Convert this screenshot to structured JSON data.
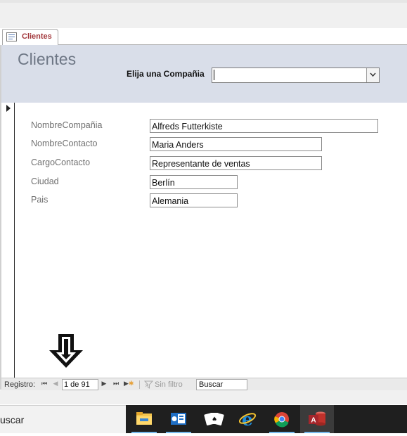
{
  "tab": {
    "label": "Clientes",
    "icon": "form-icon"
  },
  "header": {
    "title": "Clientes",
    "combo_label": "Elija una Compañia",
    "combo_value": ""
  },
  "fields": [
    {
      "label": "NombreCompañia",
      "value": "Alfreds Futterkiste"
    },
    {
      "label": "NombreContacto",
      "value": "Maria Anders"
    },
    {
      "label": "CargoContacto",
      "value": "Representante de ventas"
    },
    {
      "label": "Ciudad",
      "value": "Berlín"
    },
    {
      "label": "Pais",
      "value": "Alemania"
    }
  ],
  "nav": {
    "label": "Registro:",
    "record": "1 de 91",
    "filter": "Sin filtro",
    "search": "Buscar"
  },
  "taskbar": {
    "search_text": "uscar",
    "apps": [
      "file-explorer-icon",
      "outlook-icon",
      "solitaire-icon",
      "internet-explorer-icon",
      "chrome-icon",
      "access-icon"
    ]
  },
  "colors": {
    "header_bg": "#d9dee9",
    "tab_text": "#a2373b",
    "access_red": "#c0312b"
  }
}
